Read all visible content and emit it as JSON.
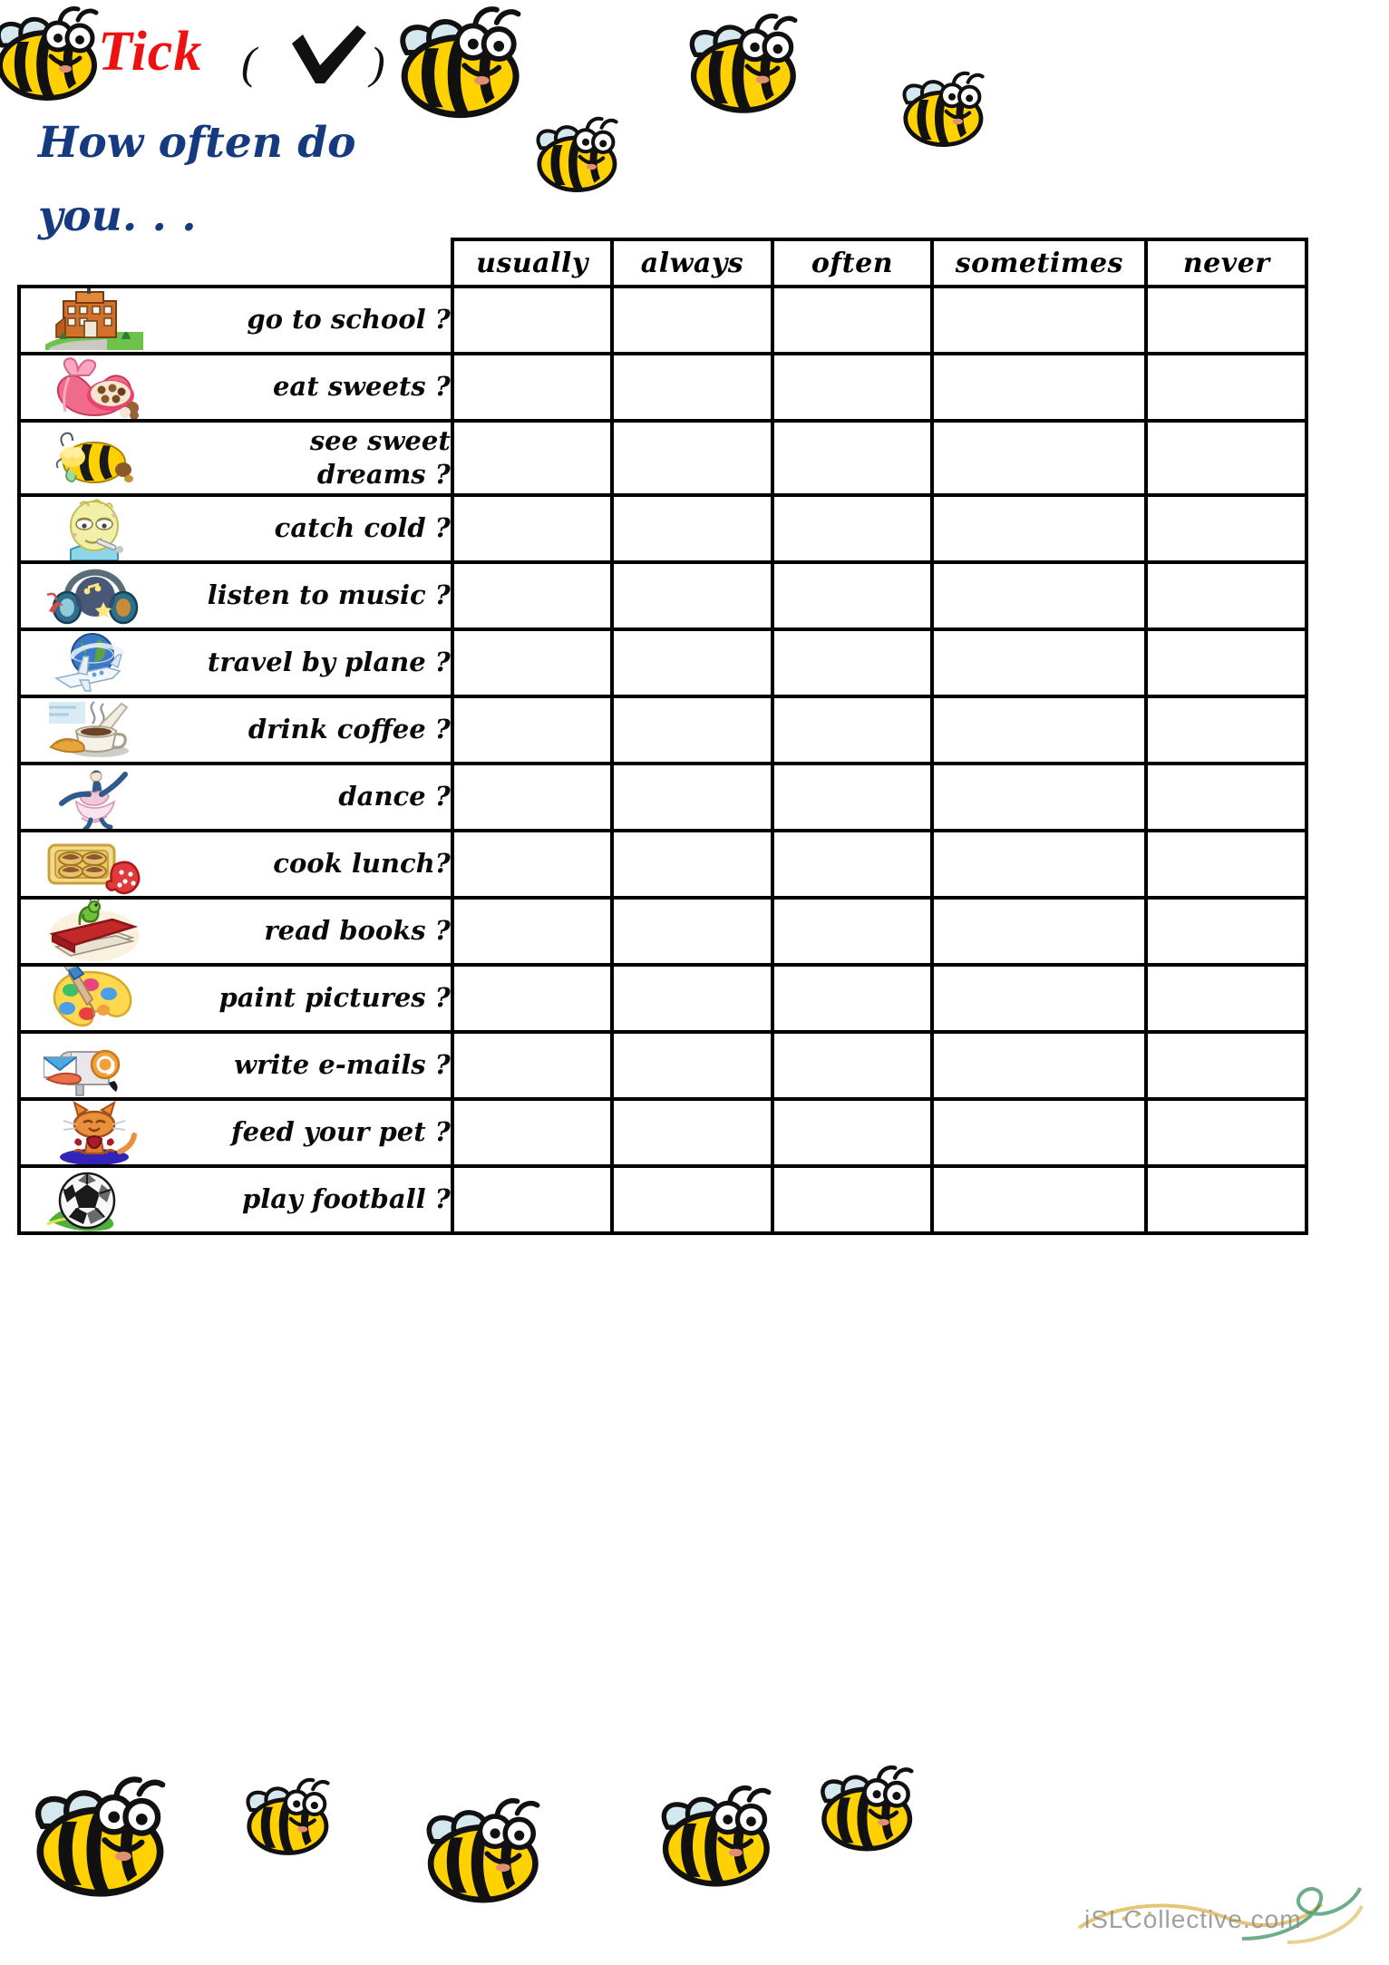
{
  "header": {
    "tick_label": "Tick",
    "paren_open": "(",
    "paren_close": ")",
    "check_icon": "check-mark-icon",
    "prompt_text": "How often do\nyou. . .",
    "tick_color": "#ee1111",
    "prompt_color": "#153a80"
  },
  "table": {
    "columns": [
      "usually",
      "always",
      "often",
      "sometimes",
      "never"
    ],
    "rows": [
      {
        "icon": "school-building-icon",
        "label": "go to school ?"
      },
      {
        "icon": "box-of-chocolates-icon",
        "label": "eat sweets ?"
      },
      {
        "icon": "sleeping-bee-icon",
        "label": "see  sweet\ndreams ?"
      },
      {
        "icon": "sick-child-icon",
        "label": "catch cold ?"
      },
      {
        "icon": "headphones-music-icon",
        "label": "listen to music ?"
      },
      {
        "icon": "globe-airplane-icon",
        "label": "travel by plane ?"
      },
      {
        "icon": "coffee-cup-icon",
        "label": "drink  coffee ?"
      },
      {
        "icon": "dancer-icon",
        "label": "dance ?"
      },
      {
        "icon": "baking-tray-oven-mitt-icon",
        "label": "cook lunch?"
      },
      {
        "icon": "book-with-worm-icon",
        "label": "read books ?"
      },
      {
        "icon": "paint-palette-brush-icon",
        "label": "paint  pictures ?"
      },
      {
        "icon": "mailbox-at-sign-icon",
        "label": "write e-mails ?"
      },
      {
        "icon": "cat-pet-icon",
        "label": "feed your pet ?"
      },
      {
        "icon": "soccer-ball-icon",
        "label": "play  football ?"
      }
    ]
  },
  "decorations": {
    "bee_icon": "bumblebee-icon",
    "bee_body_color": "#FFD100",
    "bee_stripe_color": "#111111",
    "bee_wing_color": "#D6E8EF"
  },
  "watermark": {
    "text": "iSLCollective.com",
    "swirl_icon": "decorative-swirl-icon"
  }
}
